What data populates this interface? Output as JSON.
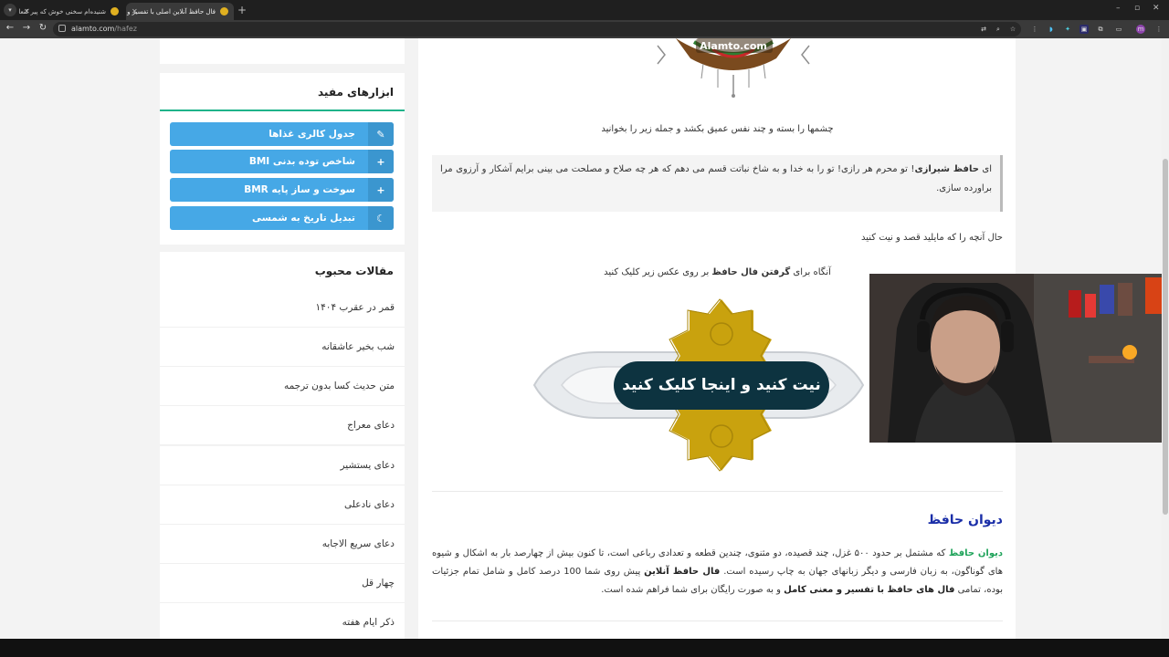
{
  "browser": {
    "tabs": [
      {
        "title": "شنیده‌ام سخنی خوش که پیر کنعان",
        "active": false
      },
      {
        "title": "فال حافظ آنلاین اصلی با تفسیر و",
        "active": true
      }
    ],
    "url_host": "alamto.com",
    "url_path": "/hafez",
    "profile_initial": "m"
  },
  "sidebar": {
    "tools_title": "ابزارهای مفید",
    "tools": [
      {
        "label": "جدول کالری غذاها",
        "icon": "✎"
      },
      {
        "label": "شاخص توده بدنی BMI",
        "icon": "+"
      },
      {
        "label": "سوخت و ساز پایه BMR",
        "icon": "+"
      },
      {
        "label": "تبدیل تاریخ به شمسی",
        "icon": "☾"
      }
    ],
    "popular_title": "مقالات محبوب",
    "popular": [
      "قمر در عقرب ۱۴۰۴",
      "شب بخیر عاشقانه",
      "متن حدیث کسا بدون ترجمه",
      "دعای معراج",
      "دعای یستشیر",
      "دعای نادعلی",
      "دعای سریع الاجابه",
      "چهار قل",
      "ذکر ایام هفته"
    ]
  },
  "main": {
    "watermark": "Alamto.com",
    "instruction": "چشمها را بسته و چند نفس عمیق بکشد و جمله زیر را بخوانید",
    "quote_pre": "ای ",
    "quote_bold": "حافظ شیرازی",
    "quote_post": "! تو محرم هر رازی! تو را به خدا و به شاخ نباتت قسم می دهم که هر چه صلاح و مصلحت می بینی برایم آشکار و آرزوی مرا براورده سازی.",
    "intent": "حال آنچه را که مایلید قصد و نیت کنید",
    "click_pre": "آنگاه برای ",
    "click_bold": "گرفتن فال حافظ",
    "click_post": " بر روی عکس زیر کلیک کنید",
    "fal_button": "نیت کنید و اینجا کلیک کنید",
    "divan_title": "دیوان حافظ",
    "divan_link": "دیوان حافظ",
    "divan_text1": " که مشتمل بر حدود ۵۰۰ غزل، چند قصیده، دو مثنوی، چندین قطعه و تعدادی رباعی است، تا کنون بیش از چهارصد بار به اشکال و شیوه های گوناگون، به زبان فارسی و دیگر زبانهای جهان به چاپ رسیده است. ",
    "divan_bold1": "فال حافظ آنلاین",
    "divan_text2": " پیش روی شما 100 درصد کامل و شامل تمام ‌جزئیات بوده، تمامی ",
    "divan_bold2": "فال های حافظ با تفسیر و معنی کامل",
    "divan_text3": " و به صورت رایگان برای شما فراهم شده است."
  },
  "colors": {
    "accent_green": "#1fb38a",
    "tool_blue": "#46a8e6",
    "title_blue": "#1a2ea8",
    "link_green": "#1fa35a",
    "button_dark": "#0d3340"
  }
}
